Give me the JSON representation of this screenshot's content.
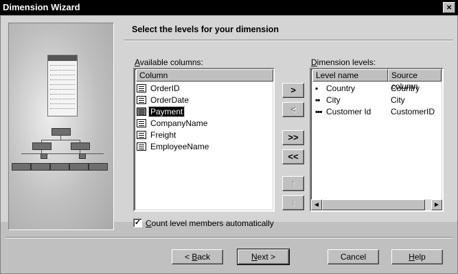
{
  "window": {
    "title": "Dimension Wizard",
    "close_glyph": "×"
  },
  "header": {
    "title": "Select the levels for your dimension"
  },
  "available": {
    "label_u": "A",
    "label_rest": "vailable columns:",
    "column_header": "Column",
    "items": [
      {
        "name": "OrderID",
        "selected": false
      },
      {
        "name": "OrderDate",
        "selected": false
      },
      {
        "name": "Payment",
        "selected": true
      },
      {
        "name": "CompanyName",
        "selected": false
      },
      {
        "name": "Freight",
        "selected": false
      },
      {
        "name": "EmployeeName",
        "selected": false
      }
    ]
  },
  "move_buttons": {
    "add": ">",
    "remove": "<",
    "add_all": ">>",
    "remove_all": "<<",
    "up": "↑",
    "down": "↓"
  },
  "levels": {
    "label_u": "D",
    "label_rest": "imension levels:",
    "headers": {
      "level": "Level name",
      "source": "Source column"
    },
    "items": [
      {
        "marker": "▪",
        "level": "Country",
        "source": "Country"
      },
      {
        "marker": "▪▪",
        "level": "City",
        "source": "City"
      },
      {
        "marker": "▪▪▪",
        "level": "Customer Id",
        "source": "CustomerID"
      }
    ],
    "scroll_left": "◀",
    "scroll_right": "▶"
  },
  "checkbox": {
    "checked": true,
    "mark": "✓",
    "label_u": "C",
    "label_rest": "ount level members automatically"
  },
  "footer": {
    "back_arrow": "< ",
    "back_u": "B",
    "back_rest": "ack",
    "next_u": "N",
    "next_rest": "ext >",
    "cancel": "Cancel",
    "help_u": "H",
    "help_rest": "elp"
  }
}
